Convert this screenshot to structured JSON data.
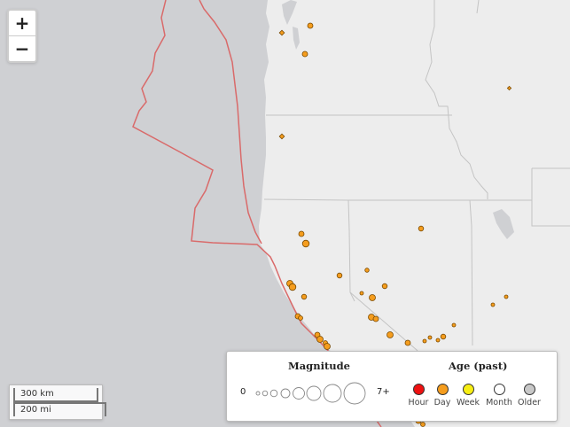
{
  "map": {
    "colors": {
      "ocean": "#cfd0d3",
      "land": "#ededed",
      "borders": "#c4c4c4",
      "plate_boundary": "#d96a6a",
      "quake_fill": "#f59d1e",
      "quake_stroke": "#7a4a00"
    }
  },
  "zoom": {
    "in_label": "+",
    "out_label": "−"
  },
  "scale": {
    "km_label": "300 km",
    "mi_label": "200 mi"
  },
  "legend": {
    "magnitude_title": "Magnitude",
    "magnitude_min": "0",
    "magnitude_max": "7+",
    "age_title": "Age (past)",
    "age_items": [
      {
        "label": "Hour",
        "color": "#ee1111"
      },
      {
        "label": "Day",
        "color": "#f59d1e"
      },
      {
        "label": "Week",
        "color": "#f7ee13"
      },
      {
        "label": "Month",
        "color": "#ffffff"
      },
      {
        "label": "Older",
        "color": "#c8c8c8"
      }
    ]
  }
}
